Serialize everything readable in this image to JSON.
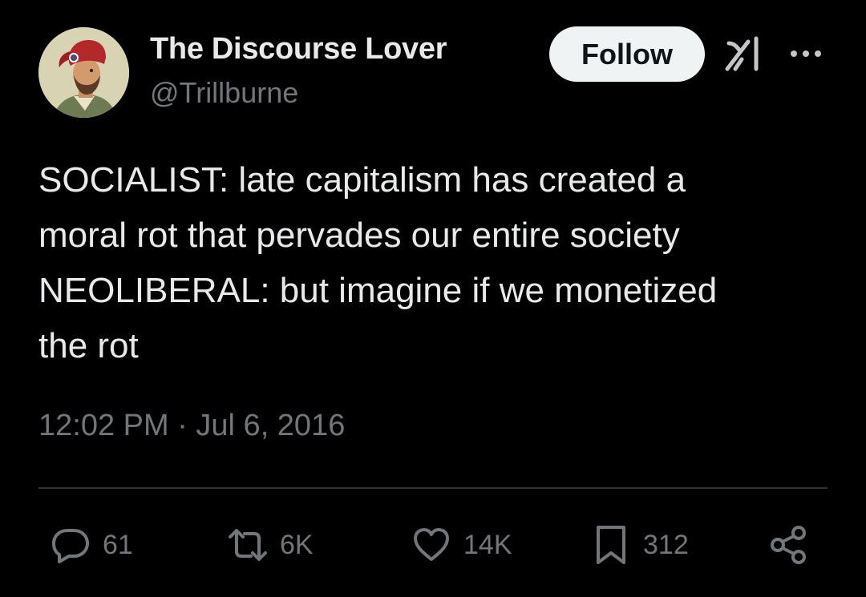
{
  "author": {
    "display_name": "The Discourse Lover",
    "handle": "@Trillburne",
    "avatar_icon": "portrait-avatar"
  },
  "follow_label": "Follow",
  "header_icons": [
    "grok-icon",
    "more-icon"
  ],
  "tweet": {
    "lines": [
      "SOCIALIST: late capitalism has created a",
      "moral rot that pervades our entire society",
      "NEOLIBERAL: but imagine if we monetized",
      "the rot"
    ],
    "timestamp": "12:02 PM · Jul 6, 2016"
  },
  "actions": {
    "reply": {
      "icon": "reply-icon",
      "count": "61"
    },
    "retweet": {
      "icon": "retweet-icon",
      "count": "6K"
    },
    "like": {
      "icon": "heart-icon",
      "count": "14K"
    },
    "bookmark": {
      "icon": "bookmark-icon",
      "count": "312"
    },
    "share": {
      "icon": "share-icon"
    }
  },
  "colors": {
    "background": "#000000",
    "primary_text": "#e7e9ea",
    "secondary_text": "#71767b",
    "follow_button_bg": "#eff3f4",
    "follow_button_text": "#0f1419",
    "divider": "#2f3336"
  }
}
